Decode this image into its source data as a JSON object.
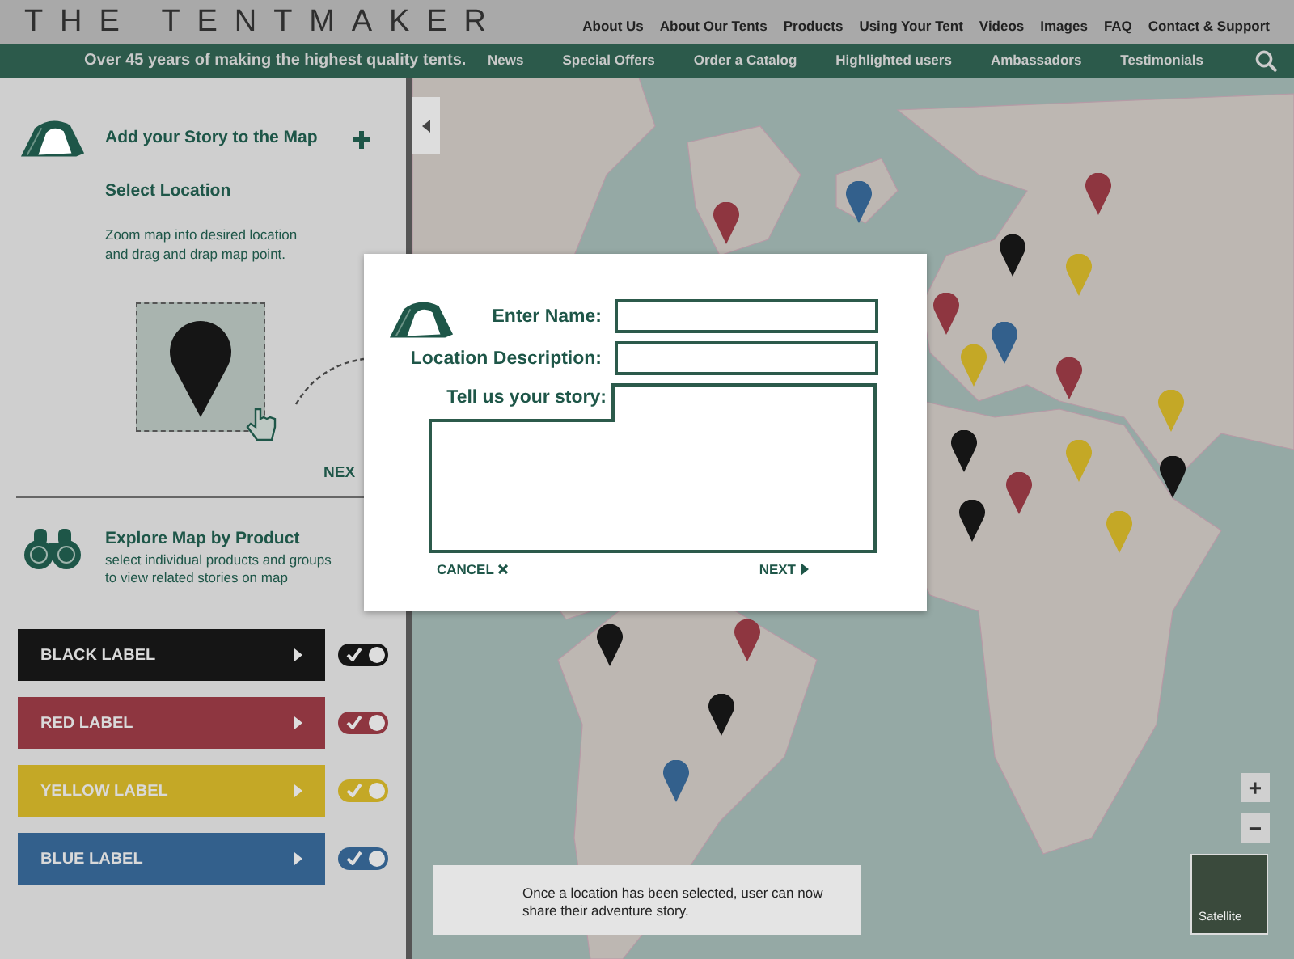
{
  "header": {
    "logo": "THE TENTMAKER",
    "top_nav": [
      "About Us",
      "About Our Tents",
      "Products",
      "Using Your Tent",
      "Videos",
      "Images",
      "FAQ",
      "Contact & Support"
    ],
    "tagline": "Over 45 years of making the highest quality tents.",
    "main_nav": [
      "News",
      "Special Offers",
      "Order a Catalog",
      "Highlighted users",
      "Ambassadors",
      "Testimonials"
    ]
  },
  "sidebar": {
    "add_story": {
      "title": "Add your Story to the Map",
      "step": "Select Location",
      "instructions": "Zoom map into desired location and drag and drap map point.",
      "next": "NEX"
    },
    "explore": {
      "title": "Explore Map by Product",
      "description": "select individual products and groups to view related stories on map"
    },
    "labels": [
      {
        "name": "BLACK LABEL",
        "color": "#151515",
        "on": true
      },
      {
        "name": "RED LABEL",
        "color": "#8e3640",
        "on": true
      },
      {
        "name": "YELLOW LABEL",
        "color": "#c4a826",
        "on": true
      },
      {
        "name": "BLUE LABEL",
        "color": "#33608c",
        "on": true
      }
    ]
  },
  "map": {
    "pins": [
      {
        "color": "#8e3640"
      },
      {
        "color": "#33608c"
      },
      {
        "color": "#8e3640"
      },
      {
        "color": "#151515"
      },
      {
        "color": "#c4a826"
      },
      {
        "color": "#8e3640"
      },
      {
        "color": "#33608c"
      },
      {
        "color": "#c4a826"
      },
      {
        "color": "#8e3640"
      },
      {
        "color": "#c4a826"
      },
      {
        "color": "#151515"
      },
      {
        "color": "#c4a826"
      },
      {
        "color": "#8e3640"
      },
      {
        "color": "#151515"
      },
      {
        "color": "#151515"
      },
      {
        "color": "#c4a826"
      },
      {
        "color": "#151515"
      },
      {
        "color": "#8e3640"
      },
      {
        "color": "#151515"
      },
      {
        "color": "#33608c"
      }
    ],
    "zoom_in": "+",
    "zoom_out": "−",
    "satellite": "Satellite",
    "info": "Once a location has been selected, user can now share their adventure story."
  },
  "dialog": {
    "fields": [
      {
        "label": "Enter Name:",
        "kind": "input"
      },
      {
        "label": "Location Description:",
        "kind": "input"
      },
      {
        "label": "Tell us your story:",
        "kind": "textarea"
      }
    ],
    "cancel": "CANCEL",
    "next": "NEXT"
  }
}
